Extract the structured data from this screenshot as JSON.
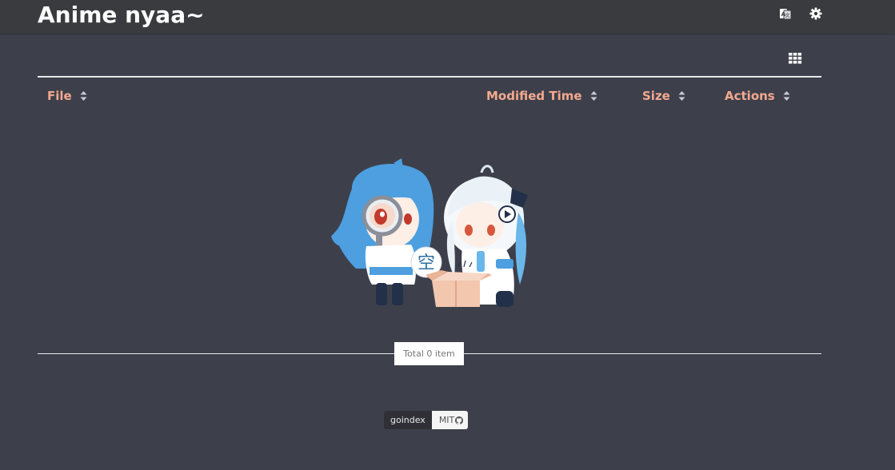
{
  "header": {
    "title": "Anime nyaa~",
    "icons": [
      "translate-icon",
      "gear-icon"
    ]
  },
  "toolbar": {
    "view_toggle_icon": "grid-view-icon"
  },
  "table": {
    "columns": [
      {
        "label": "File",
        "icon": "sort-icon"
      },
      {
        "label": "Modified Time",
        "icon": "sort-icon"
      },
      {
        "label": "Size",
        "icon": "sort-icon"
      },
      {
        "label": "Actions",
        "icon": "sort-icon"
      }
    ],
    "rows": []
  },
  "empty_state": {
    "illustration": "empty-box-mascots",
    "glyph": "空"
  },
  "summary": {
    "total_text": "Total 0 item"
  },
  "footer": {
    "badge_left": "goindex",
    "badge_right": "MIT",
    "badge_icon": "github-icon"
  },
  "colors": {
    "background": "#3d404b",
    "navbar": "#3a3b3f",
    "accent": "#f4a98f",
    "title": "#ffffff",
    "rule": "#e8e8e8"
  }
}
